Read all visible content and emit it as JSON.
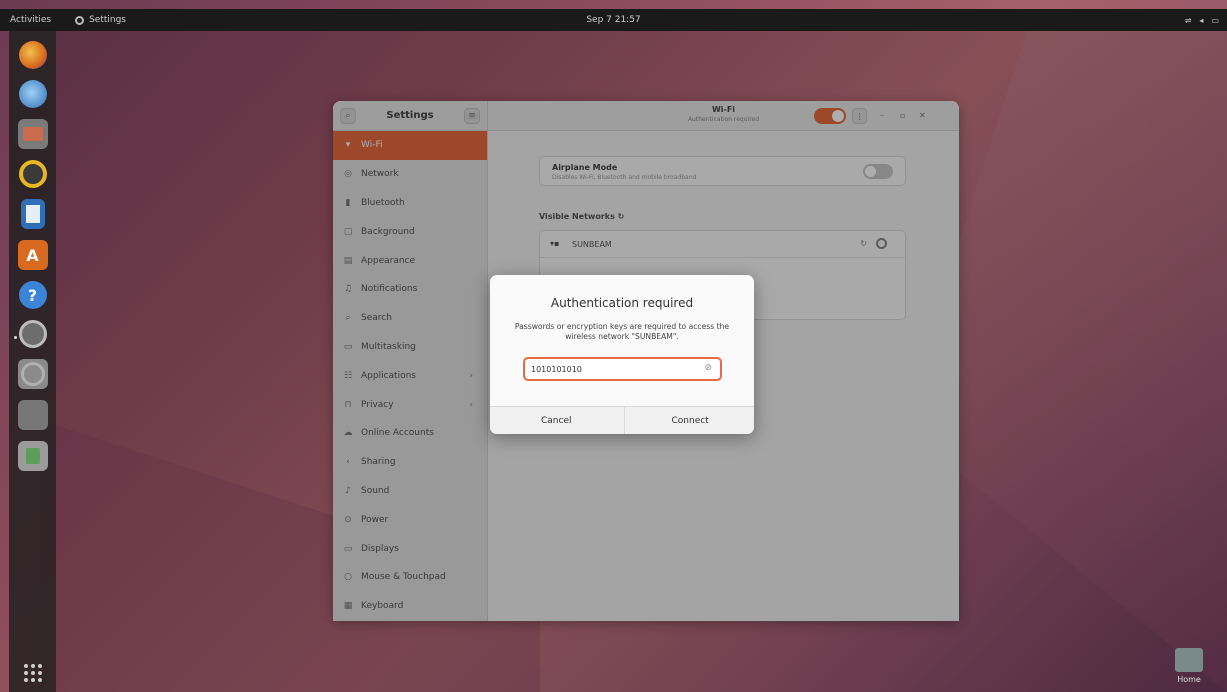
{
  "topbar": {
    "activities": "Activities",
    "app_name": "Settings",
    "clock": "Sep 7  21:57"
  },
  "dock": {
    "items": [
      "firefox",
      "thunderbird",
      "files",
      "rhythmbox",
      "libreoffice-writer",
      "ubuntu-software",
      "help",
      "settings",
      "disc",
      "drive",
      "trash"
    ]
  },
  "desktop": {
    "home_label": "Home"
  },
  "settings": {
    "sidebar_title": "Settings",
    "items": [
      {
        "label": "Wi-Fi",
        "icon": "wifi-icon"
      },
      {
        "label": "Network",
        "icon": "network-icon"
      },
      {
        "label": "Bluetooth",
        "icon": "bluetooth-icon"
      },
      {
        "label": "Background",
        "icon": "background-icon"
      },
      {
        "label": "Appearance",
        "icon": "appearance-icon"
      },
      {
        "label": "Notifications",
        "icon": "bell-icon"
      },
      {
        "label": "Search",
        "icon": "search-icon"
      },
      {
        "label": "Multitasking",
        "icon": "multitasking-icon"
      },
      {
        "label": "Applications",
        "icon": "applications-icon"
      },
      {
        "label": "Privacy",
        "icon": "lock-icon"
      },
      {
        "label": "Online Accounts",
        "icon": "cloud-icon"
      },
      {
        "label": "Sharing",
        "icon": "share-icon"
      },
      {
        "label": "Sound",
        "icon": "music-note-icon"
      },
      {
        "label": "Power",
        "icon": "power-icon"
      },
      {
        "label": "Displays",
        "icon": "display-icon"
      },
      {
        "label": "Mouse & Touchpad",
        "icon": "mouse-icon"
      },
      {
        "label": "Keyboard",
        "icon": "keyboard-icon"
      }
    ]
  },
  "wifi": {
    "title": "Wi-Fi",
    "subtitle": "Authentication required",
    "airplane_title": "Airplane Mode",
    "airplane_desc": "Disables Wi-Fi, Bluetooth and mobile broadband",
    "visible_networks": "Visible Networks",
    "networks": [
      {
        "name": "SUNBEAM"
      }
    ]
  },
  "dialog": {
    "title": "Authentication required",
    "message": "Passwords or encryption keys are required to access the wireless network \"SUNBEAM\".",
    "password": "1010101010",
    "cancel": "Cancel",
    "connect": "Connect"
  },
  "colors": {
    "accent": "#e86b3f"
  }
}
